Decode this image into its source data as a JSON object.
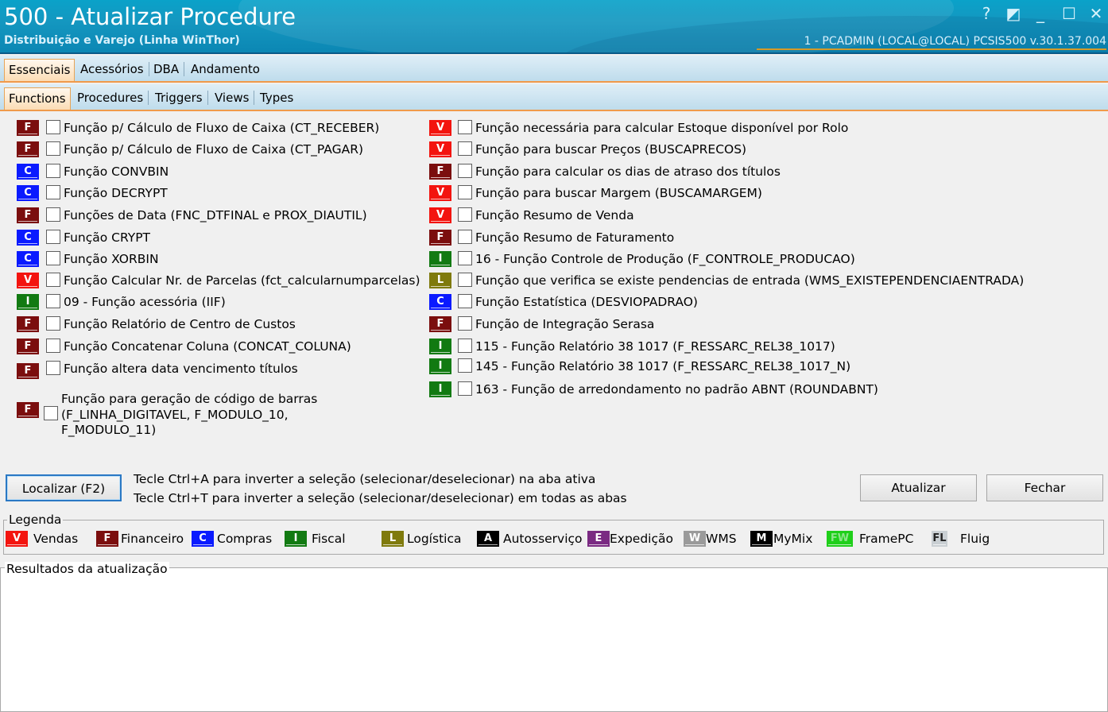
{
  "window": {
    "title": "500 - Atualizar Procedure",
    "subtitle": "Distribuição e Varejo (Linha WinThor)",
    "status": "1 - PCADMIN (LOCAL@LOCAL)   PCSIS500  v.30.1.37.004",
    "controls": {
      "help": "?",
      "restore": "◩",
      "minimize": "_",
      "maximize": "☐",
      "close": "✕"
    }
  },
  "main_tabs": [
    "Essenciais",
    "Acessórios",
    "DBA",
    "Andamento"
  ],
  "sub_tabs": [
    "Functions",
    "Procedures",
    "Triggers",
    "Views",
    "Types"
  ],
  "left_items": [
    {
      "code": "F",
      "label": "Função p/ Cálculo de Fluxo de Caixa (CT_RECEBER)"
    },
    {
      "code": "F",
      "label": "Função p/ Cálculo de Fluxo de Caixa (CT_PAGAR)"
    },
    {
      "code": "C",
      "label": "Função CONVBIN"
    },
    {
      "code": "C",
      "label": "Função DECRYPT"
    },
    {
      "code": "F",
      "label": "Funções de Data (FNC_DTFINAL e PROX_DIAUTIL)"
    },
    {
      "code": "C",
      "label": "Função CRYPT"
    },
    {
      "code": "C",
      "label": "Função XORBIN"
    },
    {
      "code": "V",
      "label": "Função Calcular Nr. de Parcelas (fct_calcularnumparcelas)"
    },
    {
      "code": "I",
      "label": "09 - Função acessória (IIF)"
    },
    {
      "code": "F",
      "label": "Função Relatório de Centro de Custos"
    },
    {
      "code": "F",
      "label": "Função Concatenar Coluna (CONCAT_COLUNA)"
    },
    {
      "code": "F",
      "label": "Função altera data vencimento títulos"
    }
  ],
  "left_multiline_item": {
    "code": "F",
    "lines": [
      "Função para geração de código de barras",
      "(F_LINHA_DIGITAVEL, F_MODULO_10,",
      "F_MODULO_11)"
    ]
  },
  "right_items": [
    {
      "code": "V",
      "label": "Função necessária para calcular Estoque disponível por Rolo"
    },
    {
      "code": "V",
      "label": "Função para buscar Preços (BUSCAPRECOS)"
    },
    {
      "code": "F",
      "label": "Função para calcular os dias de atraso dos títulos"
    },
    {
      "code": "V",
      "label": "Função para buscar Margem (BUSCAMARGEM)"
    },
    {
      "code": "V",
      "label": "Função Resumo de Venda"
    },
    {
      "code": "F",
      "label": "Função Resumo de Faturamento"
    },
    {
      "code": "I",
      "label": "16 - Função Controle de Produção (F_CONTROLE_PRODUCAO)"
    },
    {
      "code": "L",
      "label": "Função que verifica se existe pendencias de entrada (WMS_EXISTEPENDENCIAENTRADA)"
    },
    {
      "code": "C",
      "label": "Função Estatística (DESVIOPADRAO)"
    },
    {
      "code": "F",
      "label": "Função de Integração Serasa"
    },
    {
      "code": "I",
      "label": "115 - Função Relatório 38 1017 (F_RESSARC_REL38_1017)"
    },
    {
      "code": "I",
      "label": "145 - Função Relatório 38 1017 (F_RESSARC_REL38_1017_N)"
    },
    {
      "code": "I",
      "label": "163 - Função de arredondamento no padrão ABNT (ROUNDABNT)"
    }
  ],
  "actions": {
    "localizar": "Localizar (F2)",
    "hint1": "Tecle Ctrl+A para inverter a seleção (selecionar/deselecionar) na aba ativa",
    "hint2": "Tecle Ctrl+T para inverter a seleção (selecionar/deselecionar) em todas as abas",
    "atualizar": "Atualizar",
    "fechar": "Fechar"
  },
  "legend": {
    "title": "Legenda",
    "items": [
      {
        "code": "V",
        "label": "Vendas",
        "color": "#f3140f"
      },
      {
        "code": "F",
        "label": "Financeiro",
        "color": "#7b0e0e"
      },
      {
        "code": "C",
        "label": "Compras",
        "color": "#0a1aff"
      },
      {
        "code": "I",
        "label": "Fiscal",
        "color": "#127a12"
      },
      {
        "code": "L",
        "label": "Logística",
        "color": "#7f7a0d"
      },
      {
        "code": "A",
        "label": "Autosserviço",
        "color": "#000000"
      },
      {
        "code": "E",
        "label": "Expedição",
        "color": "#7a2a82"
      },
      {
        "code": "W",
        "label": "WMS",
        "color": "#9a9a9a"
      },
      {
        "code": "M",
        "label": "MyMix",
        "color": "#000000"
      },
      {
        "code": "FW",
        "label": "FramePC",
        "color": "#1fcf1a"
      },
      {
        "code": "FL",
        "label": "Fluig",
        "color": "#c9cfd3"
      }
    ]
  },
  "results": {
    "title": "Resultados da atualização"
  }
}
